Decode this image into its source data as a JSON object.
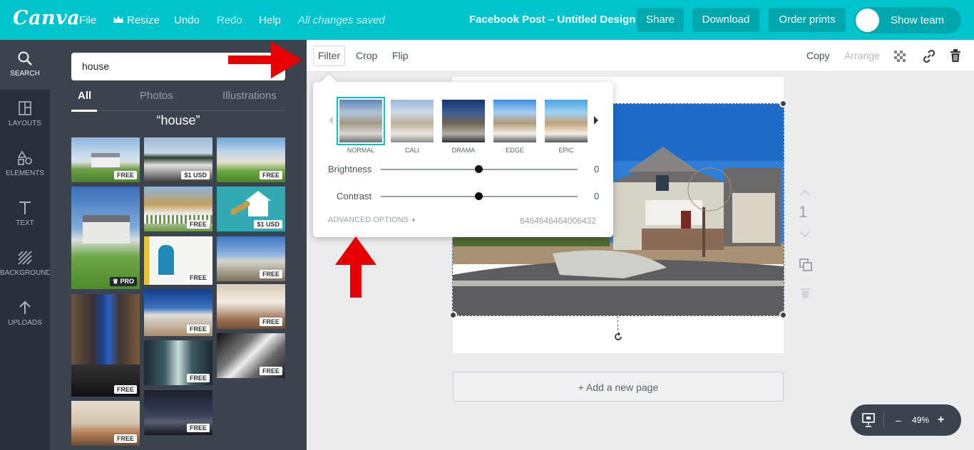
{
  "app": {
    "logo": "Canva"
  },
  "topbar": {
    "menu": {
      "file": "File",
      "resize": "Resize",
      "undo": "Undo",
      "redo": "Redo",
      "help": "Help"
    },
    "status": "All changes saved",
    "doc_title": "Facebook Post – Untitled Design",
    "share": "Share",
    "download": "Download",
    "order_prints": "Order prints",
    "show_team": "Show team"
  },
  "leftnav": {
    "items": [
      {
        "label": "SEARCH",
        "icon": "search-icon"
      },
      {
        "label": "LAYOUTS",
        "icon": "layouts-icon"
      },
      {
        "label": "ELEMENTS",
        "icon": "elements-icon"
      },
      {
        "label": "TEXT",
        "icon": "text-icon"
      },
      {
        "label": "BACKGROUND",
        "icon": "background-icon"
      },
      {
        "label": "UPLOADS",
        "icon": "upload-icon"
      }
    ]
  },
  "panel": {
    "search_value": "house",
    "tabs": [
      "All",
      "Photos",
      "Illustrations"
    ],
    "query_heading": "“house”",
    "badges": {
      "free": "FREE",
      "usd": "$1 USD",
      "pro": "PRO"
    }
  },
  "toolbar": {
    "filter": "Filter",
    "crop": "Crop",
    "flip": "Flip",
    "copy": "Copy",
    "arrange": "Arrange"
  },
  "filter_popup": {
    "filters": [
      "NORMAL",
      "CALI",
      "DRAMA",
      "EDGE",
      "EPIC"
    ],
    "brightness_label": "Brightness",
    "brightness_value": "0",
    "contrast_label": "Contrast",
    "contrast_value": "0",
    "advanced": "ADVANCED OPTIONS",
    "code": "6464646464006432"
  },
  "canvas": {
    "page_number": "1",
    "add_page": "+ Add a new page"
  },
  "zoom": {
    "minus": "–",
    "level": "49%",
    "plus": "+"
  },
  "colors": {
    "brand": "#00c4cc",
    "dark_nav": "#293039",
    "panel": "#3b434e",
    "annotation_arrow": "#e60000"
  }
}
